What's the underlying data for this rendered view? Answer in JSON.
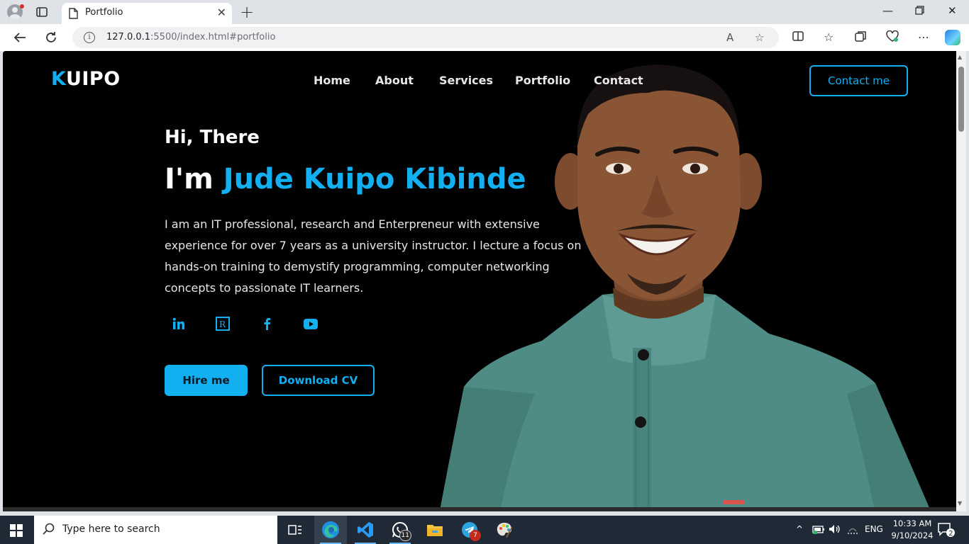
{
  "browser": {
    "tab_title": "Portfolio",
    "url_host": "127.0.0.1",
    "url_rest": ":5500/index.html#portfolio"
  },
  "site": {
    "logo_first": "K",
    "logo_rest": "UIPO",
    "nav": [
      "Home",
      "About",
      "Services",
      "Portfolio",
      "Contact"
    ],
    "contact_button": "Contact me",
    "greeting": "Hi, There",
    "intro_prefix": "I'm ",
    "name": "Jude Kuipo Kibinde",
    "bio": "I am an IT professional, research and Enterpreneur with extensive experience for over 7 years as a university instructor. I lecture a focus on hands-on training to demystify programming, computer networking concepts to passionate IT learners.",
    "social_icons": [
      "linkedin-icon",
      "researchgate-icon",
      "facebook-icon",
      "youtube-icon"
    ],
    "social_researchgate_glyph": "R",
    "hire_button": "Hire me",
    "cv_button": "Download CV",
    "accent_color": "#12b0f0"
  },
  "taskbar": {
    "search_placeholder": "Type here to search",
    "whatsapp_badge": "11",
    "telegram_badge": "7",
    "language": "ENG",
    "time": "10:33 AM",
    "date": "9/10/2024",
    "notifications": "2"
  }
}
